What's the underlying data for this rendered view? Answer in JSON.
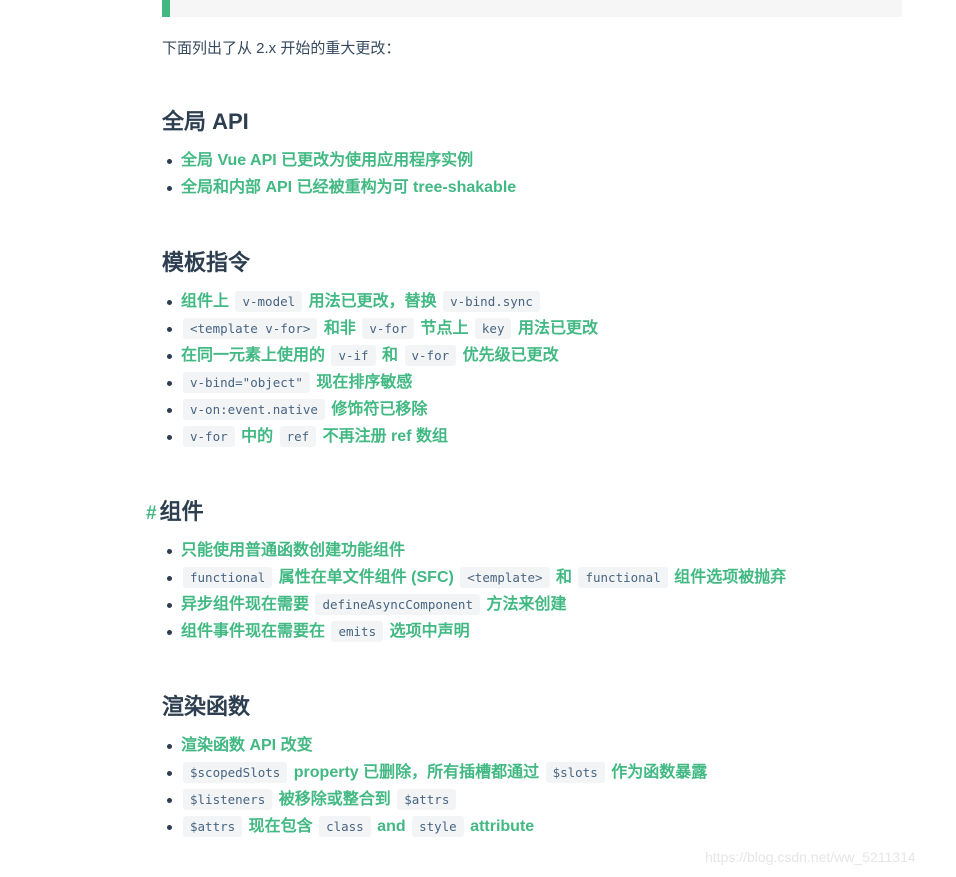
{
  "intro": "下面列出了从 2.x 开始的重大更改：",
  "sections": {
    "global_api": {
      "title": "全局 API",
      "items": [
        "全局 Vue API 已更改为使用应用程序实例",
        "全局和内部 API 已经被重构为可 tree-shakable"
      ]
    },
    "template": {
      "title": "模板指令",
      "i0": {
        "t0": "组件上",
        "c0": "v-model",
        "t1": "用法已更改，替换",
        "c1": "v-bind.sync"
      },
      "i1": {
        "c0": "<template v-for>",
        "t0": "和非",
        "c1": "v-for",
        "t1": "节点上",
        "c2": "key",
        "t2": "用法已更改"
      },
      "i2": {
        "t0": "在同一元素上使用的",
        "c0": "v-if",
        "t1": "和",
        "c1": "v-for",
        "t2": "优先级已更改"
      },
      "i3": {
        "c0": "v-bind=\"object\"",
        "t0": "现在排序敏感"
      },
      "i4": {
        "c0": "v-on:event.native",
        "t0": "修饰符已移除"
      },
      "i5": {
        "c0": "v-for",
        "t0": "中的",
        "c1": "ref",
        "t1": "不再注册 ref 数组"
      }
    },
    "components": {
      "anchor": "#",
      "title": "组件",
      "i0": {
        "t0": "只能使用普通函数创建功能组件"
      },
      "i1": {
        "c0": "functional",
        "t0": "属性在单文件组件 (SFC)",
        "c1": "<template>",
        "t1": "和",
        "c2": "functional",
        "t2": "组件选项被抛弃"
      },
      "i2": {
        "t0": "异步组件现在需要",
        "c0": "defineAsyncComponent",
        "t1": "方法来创建"
      },
      "i3": {
        "t0": "组件事件现在需要在",
        "c0": "emits",
        "t1": "选项中声明"
      }
    },
    "render": {
      "title": "渲染函数",
      "i0": {
        "t0": "渲染函数 API 改变"
      },
      "i1": {
        "c0": "$scopedSlots",
        "t0": "property 已删除，所有插槽都通过",
        "c1": "$slots",
        "t1": "作为函数暴露"
      },
      "i2": {
        "c0": "$listeners",
        "t0": "被移除或整合到",
        "c1": "$attrs"
      },
      "i3": {
        "c0": "$attrs",
        "t0": "现在包含",
        "c1": "class",
        "t1": "and",
        "c2": "style",
        "t2": "attribute"
      }
    }
  },
  "watermark": "https://blog.csdn.net/ww_5211314",
  "colors": {
    "accent": "#42b983",
    "heading": "#2c3e50",
    "code_bg": "#f3f4f5",
    "code_text": "#476582"
  }
}
